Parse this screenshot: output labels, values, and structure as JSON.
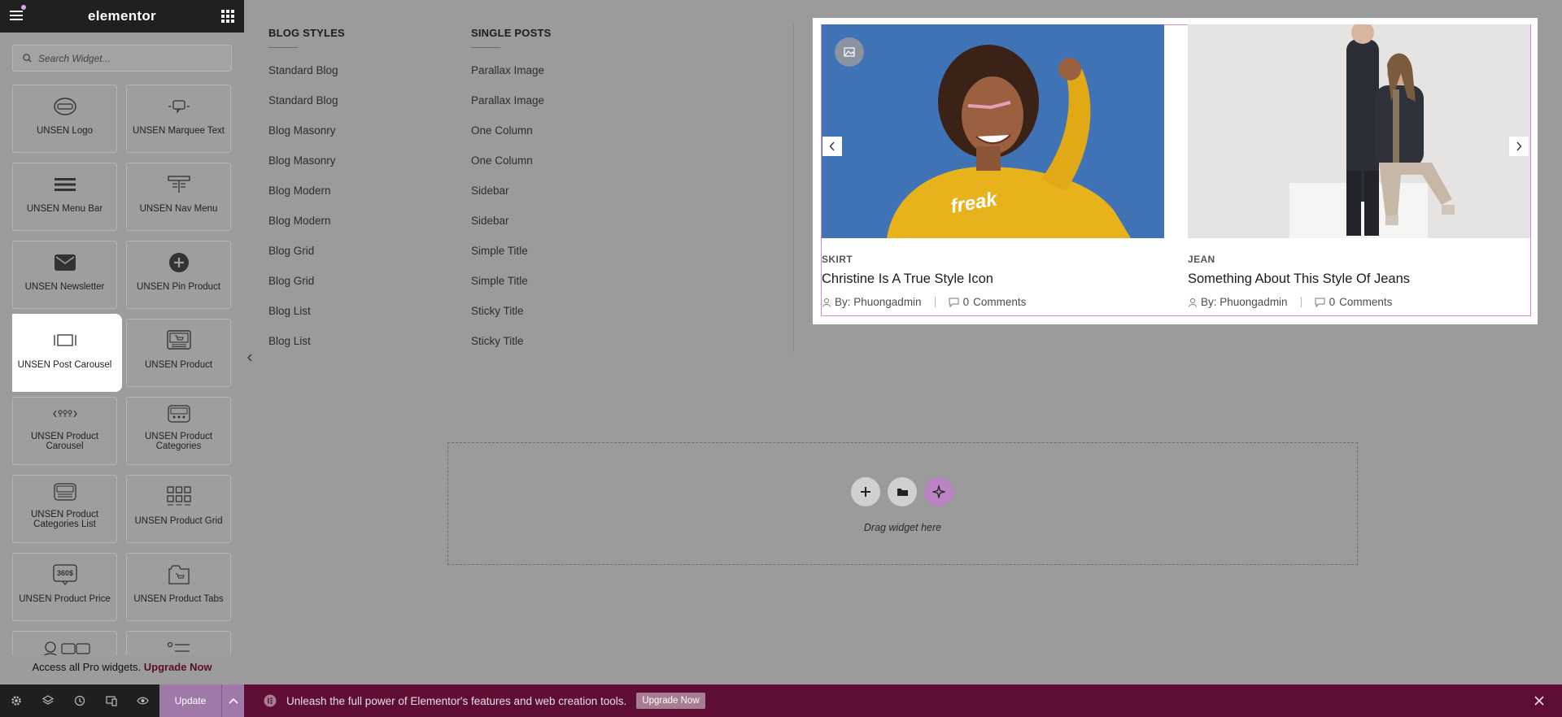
{
  "panel": {
    "brand": "elementor",
    "search_placeholder": "Search Widget...",
    "widgets": [
      {
        "label": "UNSEN Logo",
        "icon": "logo-icon"
      },
      {
        "label": "UNSEN Marquee Text",
        "icon": "marquee-text-icon"
      },
      {
        "label": "UNSEN Menu Bar",
        "icon": "menu-bar-icon"
      },
      {
        "label": "UNSEN Nav Menu",
        "icon": "nav-menu-icon"
      },
      {
        "label": "UNSEN Newsletter",
        "icon": "envelope-icon"
      },
      {
        "label": "UNSEN Pin Product",
        "icon": "plus-circle-icon"
      },
      {
        "label": "UNSEN Post Carousel",
        "icon": "post-carousel-icon"
      },
      {
        "label": "UNSEN Product",
        "icon": "product-icon"
      },
      {
        "label": "UNSEN Product Carousel",
        "icon": "product-carousel-icon"
      },
      {
        "label": "UNSEN Product Categories",
        "icon": "product-categories-icon"
      },
      {
        "label": "UNSEN Product Categories List",
        "icon": "product-categories-list-icon"
      },
      {
        "label": "UNSEN Product Grid",
        "icon": "product-grid-icon"
      },
      {
        "label": "UNSEN Product Price",
        "icon": "product-price-icon"
      },
      {
        "label": "UNSEN Product Tabs",
        "icon": "product-tabs-icon"
      }
    ],
    "price_tag": "360$",
    "pro_text": "Access all Pro widgets.",
    "pro_link": "Upgrade Now",
    "update_label": "Update"
  },
  "menus": {
    "blog_styles": {
      "title": "BLOG STYLES",
      "items": [
        "Standard Blog",
        "Standard Blog",
        "Blog Masonry",
        "Blog Masonry",
        "Blog Modern",
        "Blog Modern",
        "Blog Grid",
        "Blog Grid",
        "Blog List",
        "Blog List"
      ]
    },
    "single_posts": {
      "title": "SINGLE POSTS",
      "items": [
        "Parallax Image",
        "Parallax Image",
        "One Column",
        "One Column",
        "Sidebar",
        "Sidebar",
        "Simple Title",
        "Simple Title",
        "Sticky Title",
        "Sticky Title"
      ]
    }
  },
  "carousel": {
    "posts": [
      {
        "category": "SKIRT",
        "title": "Christine Is A True Style Icon",
        "author": "By: Phuongadmin",
        "comments_count": "0",
        "comments_label": "Comments"
      },
      {
        "category": "JEAN",
        "title": "Something About This Style Of Jeans",
        "author": "By: Phuongadmin",
        "comments_count": "0",
        "comments_label": "Comments"
      }
    ],
    "image_text": "freak"
  },
  "dropzone": {
    "text": "Drag widget here"
  },
  "notice": {
    "text": "Unleash the full power of Elementor's features and web creation tools.",
    "button": "Upgrade Now"
  },
  "colors": {
    "accent": "#9f7aa8",
    "notice_bg": "#5e0e34",
    "selection_border": "#d08ad9"
  }
}
